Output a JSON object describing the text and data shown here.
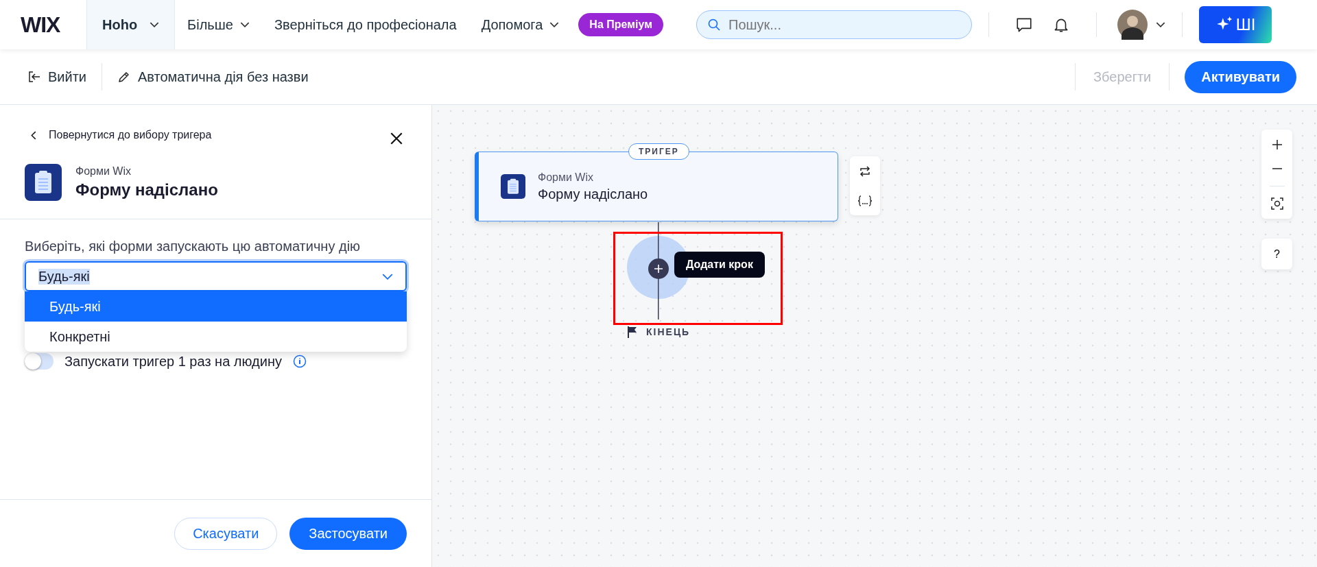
{
  "nav": {
    "logo": "WIX",
    "site": "Hoho",
    "items": [
      {
        "label": "Більше",
        "dropdown": true
      },
      {
        "label": "Зверніться до професіонала",
        "dropdown": false
      },
      {
        "label": "Допомога",
        "dropdown": true
      }
    ],
    "premium": "На Преміум",
    "search": {
      "placeholder": "Пошук..."
    },
    "ai_button": "ШІ"
  },
  "toolbar": {
    "exit": "Вийти",
    "name": "Автоматична дія без назви",
    "save": {
      "label": "Зберегти",
      "disabled": true
    },
    "activate": "Активувати"
  },
  "panel": {
    "back": "Повернутися до вибору тригера",
    "app": "Форми Wix",
    "title": "Форму надіслано",
    "field_label": "Виберіть, які форми запускають цю автоматичну дію",
    "select": {
      "value": "Будь-які",
      "expanded": true,
      "options": [
        {
          "label": "Будь-які",
          "selected": true
        },
        {
          "label": "Конкретні",
          "selected": false
        }
      ]
    },
    "toggle": {
      "label": "Запускати тригер 1 раз на людину",
      "on": false
    },
    "cancel": "Скасувати",
    "apply": "Застосувати"
  },
  "canvas": {
    "trigger": {
      "badge": "ТРИГЕР",
      "app": "Форми Wix",
      "title": "Форму надіслано"
    },
    "add_step_tooltip": "Додати крок",
    "end": "КІНЕЦЬ",
    "help": "?"
  }
}
